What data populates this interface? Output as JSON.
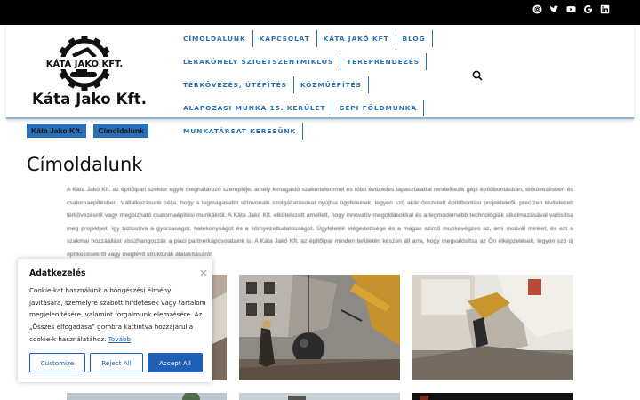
{
  "topbar": {
    "social_icons": [
      "instagram-icon",
      "twitter-icon",
      "youtube-icon",
      "google-icon",
      "linkedin-icon"
    ]
  },
  "header": {
    "logo_text": "KÁTA JAKO KFT.",
    "brand": "Káta Jako Kft."
  },
  "nav": {
    "rows": [
      [
        "CÍMOLDALUNK",
        "KAPCSOLAT",
        "KÁTA JAKÓ KFT",
        "BLOG"
      ],
      [
        "LERAKÓHELY SZIGETSZENTMIKLÓS",
        "TEREPRENDEZÉS"
      ],
      [
        "TÉRKÖVEZÉS, ÚTÉPÍTÉS",
        "KÖZMŰÉPÍTÉS"
      ],
      [
        "ALAPOZÁSI MUNKA 15. KERÜLET",
        "GÉPI FÖLDMUNKA"
      ],
      [
        "MUNKATÁRSAT KERESÜNK"
      ]
    ]
  },
  "breadcrumb": [
    "Káta Jako Kft.",
    "Címoldalunk"
  ],
  "page": {
    "title": "Címoldalunk",
    "intro": "A Káta Jakó Kft. az építőipari szektor egyik meghatározó szereplője, amely kimagasló szakértelemmel és több évtizedes tapasztalattal rendelkezik gépi építőbontásban, térkövezésben és csatornaépítésben. Vállalkozásunk célja, hogy a legmagasabb színvonalú szolgáltatásokat nyújtsa ügyfeleinek, legyen szó akár összetett építőbontási projektekről, precízen kivitelezett térkövezésről vagy megbízható csatornaépítési munkákról. A Káta Jakó Kft. elkötelezett amellett, hogy innovatív megoldásokkal és a legmodernebb technológiák alkalmazásával valósítsa meg projektjeit, így biztosítva a gyorsaságot, hatékonyságot és a környezettudatosságot. Ügyfeleink elégedettsége és a magas szintű munkavégzés az, ami motivál minket, és ezt a szakmai hozzáállást visszhangozzák a piaci partnerkapcsolataink is. A Káta Jakó Kft. az építőipar minden területén készen áll arra, hogy megvalósítsa az Ön elképzeléseit, legyen szó új építkezésekről vagy meglévő struktúrák átalakításáról."
  },
  "cookie": {
    "title": "Adatkezelés",
    "text": "Cookie-kat használunk a böngészési élmény javítására, személyre szabott hirdetések vagy tartalom megjelenítésére, valamint forgalmunk elemzésére. Az „Összes elfogadása” gombra kattintva hozzájárul a cookie-k használatához.",
    "more_link": "Tovább",
    "customize": "Customize",
    "reject": "Reject All",
    "accept": "Accept All"
  },
  "colors": {
    "accent": "#2a70b5",
    "topbar": "#000000",
    "button": "#1f5fb8"
  }
}
